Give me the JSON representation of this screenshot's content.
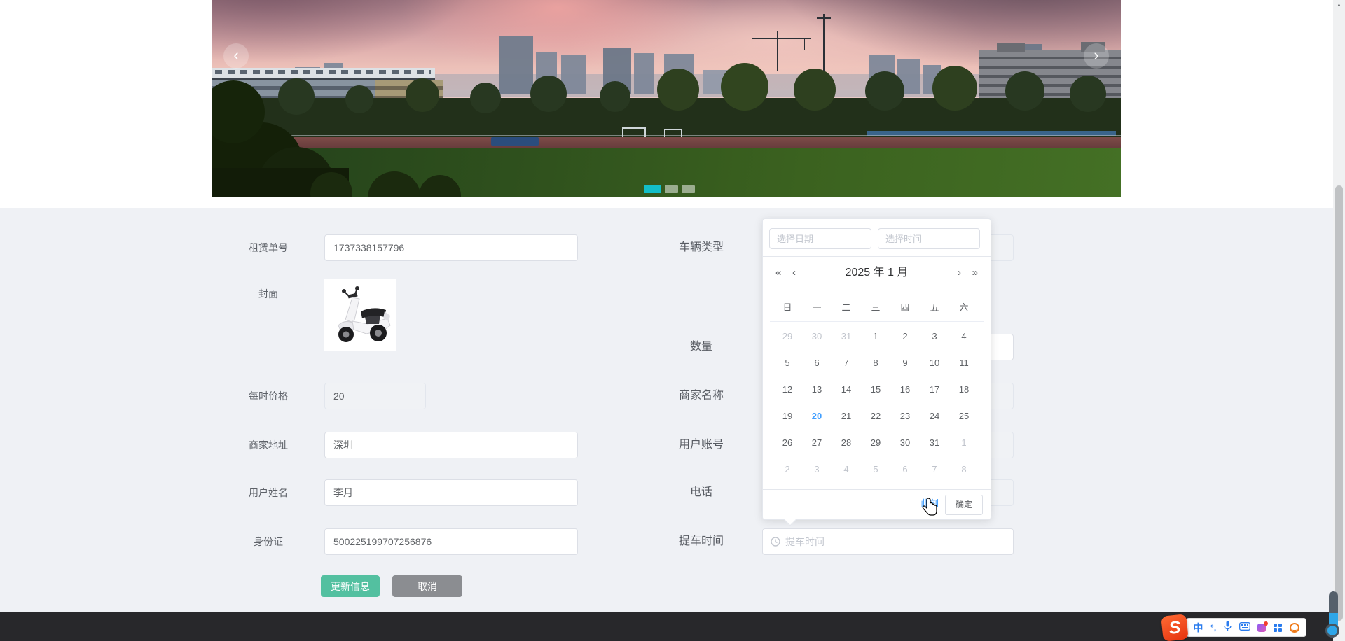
{
  "colors": {
    "accent": "#409eff",
    "update_button": "#53c0a0",
    "cancel_button": "#8b8d91",
    "carousel_active": "#13bec8",
    "page_bg": "#eff1f5",
    "taskbar": "#28282b"
  },
  "carousel": {
    "prev_icon": "‹",
    "next_icon": "›",
    "dot_count": 3,
    "active_index": 0
  },
  "form": {
    "rows_left": [
      {
        "label": "租赁单号",
        "value": "1737338157796"
      },
      {
        "label": "封面"
      },
      {
        "label": "每时价格",
        "value": "20"
      },
      {
        "label": "商家地址",
        "value": "深圳"
      },
      {
        "label": "用户姓名",
        "value": "李月"
      },
      {
        "label": "身份证",
        "value": "500225199707256876"
      }
    ],
    "rows_right": [
      {
        "label": "车辆类型"
      },
      {
        "label": "数量"
      },
      {
        "label": "商家名称"
      },
      {
        "label": "用户账号"
      },
      {
        "label": "电话"
      },
      {
        "label": "提车时间",
        "placeholder": "提车时间"
      }
    ],
    "buttons": {
      "update": "更新信息",
      "cancel": "取消"
    }
  },
  "datepicker": {
    "date_placeholder": "选择日期",
    "time_placeholder": "选择时间",
    "prev_year_icon": "«",
    "prev_month_icon": "‹",
    "next_month_icon": "›",
    "next_year_icon": "»",
    "title_year": "2025 年",
    "title_month": "1 月",
    "weekdays": [
      "日",
      "一",
      "二",
      "三",
      "四",
      "五",
      "六"
    ],
    "days": [
      {
        "d": "29",
        "muted": true
      },
      {
        "d": "30",
        "muted": true
      },
      {
        "d": "31",
        "muted": true
      },
      {
        "d": "1"
      },
      {
        "d": "2"
      },
      {
        "d": "3"
      },
      {
        "d": "4"
      },
      {
        "d": "5"
      },
      {
        "d": "6"
      },
      {
        "d": "7"
      },
      {
        "d": "8"
      },
      {
        "d": "9"
      },
      {
        "d": "10"
      },
      {
        "d": "11"
      },
      {
        "d": "12"
      },
      {
        "d": "13"
      },
      {
        "d": "14"
      },
      {
        "d": "15"
      },
      {
        "d": "16"
      },
      {
        "d": "17"
      },
      {
        "d": "18"
      },
      {
        "d": "19"
      },
      {
        "d": "20",
        "selected": true
      },
      {
        "d": "21"
      },
      {
        "d": "22"
      },
      {
        "d": "23"
      },
      {
        "d": "24"
      },
      {
        "d": "25"
      },
      {
        "d": "26"
      },
      {
        "d": "27"
      },
      {
        "d": "28"
      },
      {
        "d": "29"
      },
      {
        "d": "30"
      },
      {
        "d": "31"
      },
      {
        "d": "1",
        "muted": true
      },
      {
        "d": "2",
        "muted": true
      },
      {
        "d": "3",
        "muted": true
      },
      {
        "d": "4",
        "muted": true
      },
      {
        "d": "5",
        "muted": true
      },
      {
        "d": "6",
        "muted": true
      },
      {
        "d": "7",
        "muted": true
      },
      {
        "d": "8",
        "muted": true
      }
    ],
    "selected_day": "20",
    "now_label": "此刻",
    "confirm_label": "确定"
  },
  "ime": {
    "logo": "S",
    "lang": "中",
    "punct": "°,"
  },
  "scrollbar": {
    "up_icon": "▲"
  }
}
